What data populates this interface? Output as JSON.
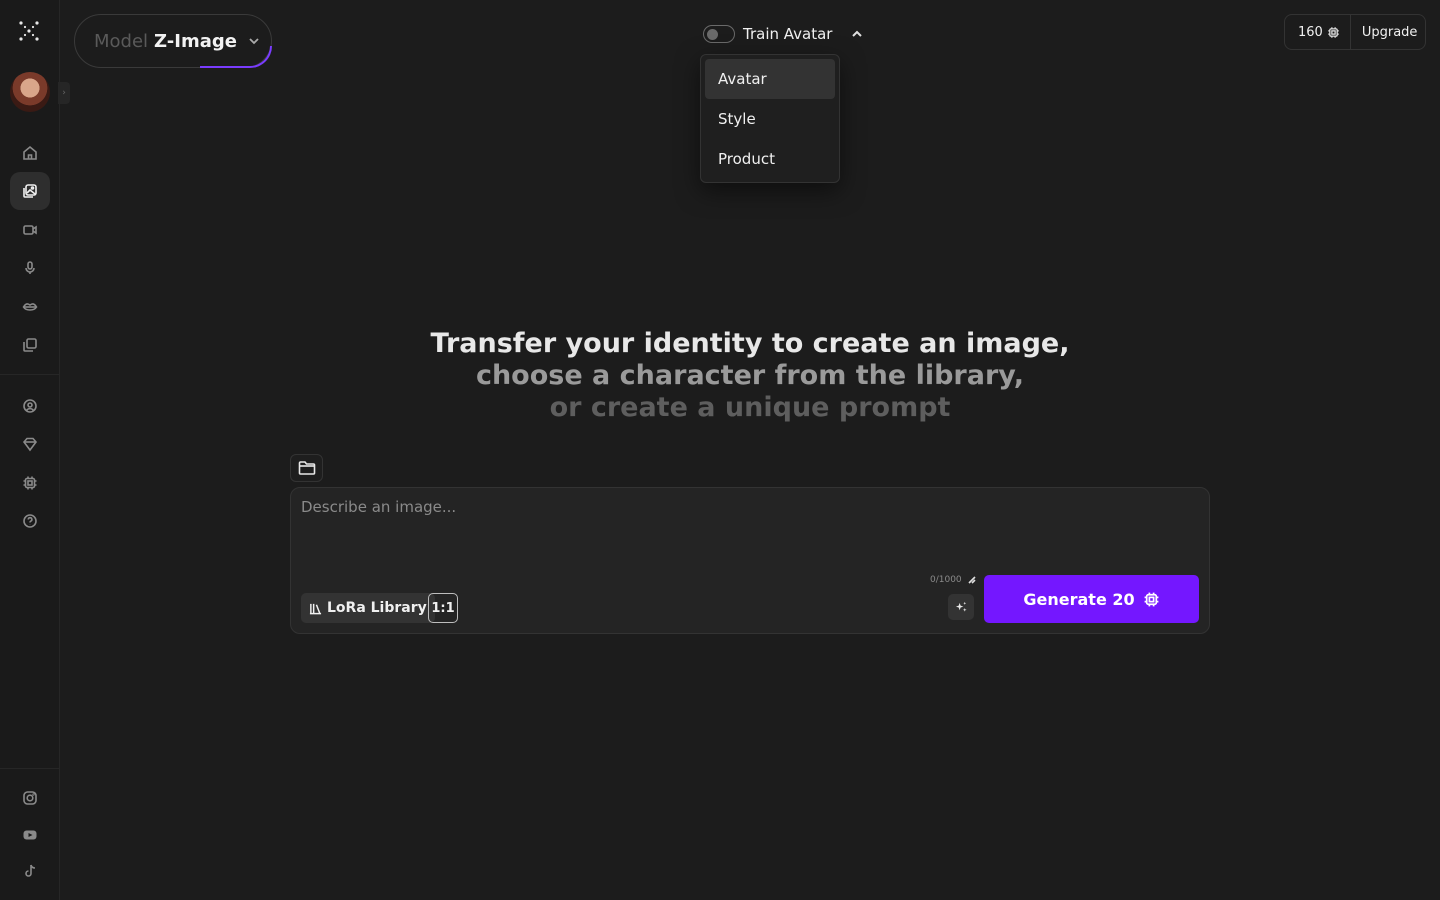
{
  "model": {
    "label": "Model",
    "value": "Z-Image"
  },
  "train": {
    "label": "Train Avatar"
  },
  "dropdown": {
    "items": [
      "Avatar",
      "Style",
      "Product"
    ]
  },
  "credits": {
    "count": "160",
    "upgrade": "Upgrade"
  },
  "headline": {
    "line1": "Transfer your identity to create an image,",
    "line2": "choose a character from the library,",
    "line3": "or create a unique prompt"
  },
  "prompt": {
    "placeholder": "Describe an image...",
    "char_count": "0/1000"
  },
  "lora": {
    "label": "LoRa Library"
  },
  "ratio": {
    "label": "1:1"
  },
  "generate": {
    "label": "Generate 20"
  },
  "colors": {
    "accent": "#7417ff",
    "background": "#1c1c1c"
  }
}
